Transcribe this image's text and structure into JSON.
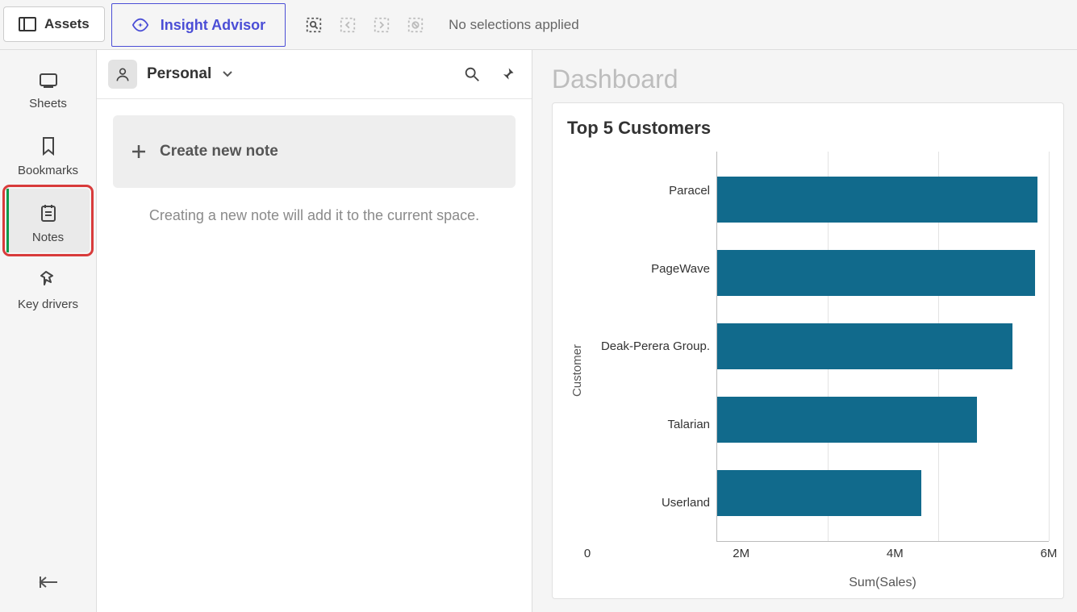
{
  "topbar": {
    "assets_label": "Assets",
    "insight_label": "Insight Advisor",
    "no_selections": "No selections applied"
  },
  "sidebar": {
    "items": [
      {
        "label": "Sheets"
      },
      {
        "label": "Bookmarks"
      },
      {
        "label": "Notes"
      },
      {
        "label": "Key drivers"
      }
    ]
  },
  "middle": {
    "scope_label": "Personal",
    "create_label": "Create new note",
    "empty_message": "Creating a new note will add it to the current space."
  },
  "dashboard": {
    "title": "Dashboard",
    "chart_title": "Top 5 Customers"
  },
  "chart_data": {
    "type": "bar",
    "orientation": "horizontal",
    "title": "Top 5 Customers",
    "ylabel": "Customer",
    "xlabel": "Sum(Sales)",
    "xlim": [
      0,
      6000000
    ],
    "x_ticks": [
      0,
      2000000,
      4000000,
      6000000
    ],
    "x_tick_labels": [
      "0",
      "2M",
      "4M",
      "6M"
    ],
    "categories": [
      "Paracel",
      "PageWave",
      "Deak-Perera Group.",
      "Talarian",
      "Userland"
    ],
    "values": [
      5800000,
      5750000,
      5350000,
      4700000,
      3700000
    ],
    "bar_color": "#116a8c"
  }
}
